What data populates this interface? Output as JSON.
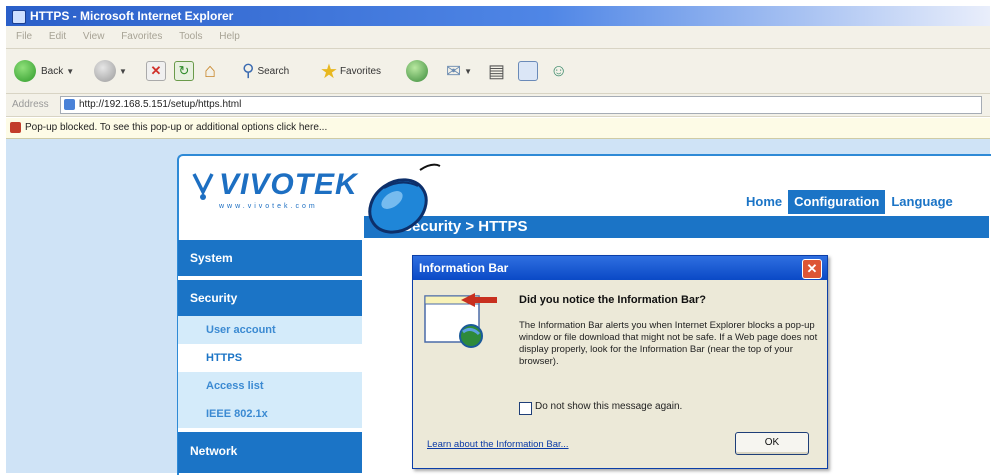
{
  "window": {
    "title": "HTTPS - Microsoft Internet Explorer"
  },
  "menubar": {
    "items": [
      "File",
      "Edit",
      "View",
      "Favorites",
      "Tools",
      "Help"
    ]
  },
  "toolbar": {
    "back_label": "Back",
    "search_label": "Search",
    "favorites_label": "Favorites"
  },
  "addressbar": {
    "label": "Address",
    "url": "http://192.168.5.151/setup/https.html"
  },
  "infobar": {
    "message": "Pop-up blocked. To see this pop-up or additional options click here..."
  },
  "site": {
    "logo_text": "VIVOTEK",
    "logo_sub": "www.vivotek.com",
    "nav": [
      "Home",
      "Configuration",
      "Language"
    ],
    "nav_active": "Configuration",
    "page_title": "Security > HTTPS",
    "sidebar": {
      "sections": [
        "System",
        "Security"
      ],
      "security_items": [
        "User account",
        "HTTPS",
        "Access list",
        "IEEE 802.1x"
      ],
      "current_item": "HTTPS",
      "bottom_section": "Network"
    }
  },
  "dialog": {
    "title": "Information Bar",
    "heading": "Did you notice the Information Bar?",
    "body": "The Information Bar alerts you when Internet Explorer blocks a pop-up window or file download that might not be safe. If a Web page does not display properly, look for the Information Bar (near the top of your browser).",
    "checkbox_label": "Do not show this message again.",
    "link": "Learn about the Information Bar...",
    "ok_label": "OK"
  },
  "colors": {
    "brand_blue": "#1b74c6",
    "sidebar_item_bg": "#d4ebfa",
    "xp_title_blue": "#0a49c6"
  }
}
